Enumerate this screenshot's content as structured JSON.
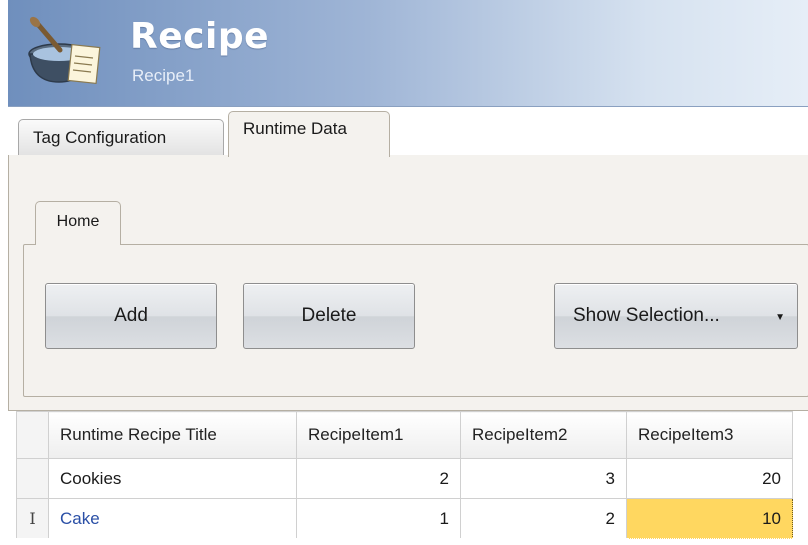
{
  "header": {
    "title": "Recipe",
    "subtitle": "Recipe1",
    "icon": "recipe-pot-icon"
  },
  "tabs": [
    {
      "label": "Tag Configuration",
      "active": false
    },
    {
      "label": "Runtime Data",
      "active": true
    }
  ],
  "ribbon": {
    "tab_label": "Home",
    "add_label": "Add",
    "delete_label": "Delete",
    "show_selection_label": "Show Selection...",
    "dropdown_icon": "triangle-down-icon"
  },
  "grid": {
    "columns": [
      "Runtime Recipe Title",
      "RecipeItem1",
      "RecipeItem2",
      "RecipeItem3"
    ],
    "rows": [
      {
        "title": "Cookies",
        "item1": "2",
        "item2": "3",
        "item3": "20"
      },
      {
        "title": "Cake",
        "item1": "1",
        "item2": "2",
        "item3": "10",
        "row_marker": "I"
      }
    ],
    "selected_cell_color": "#ffd760"
  }
}
